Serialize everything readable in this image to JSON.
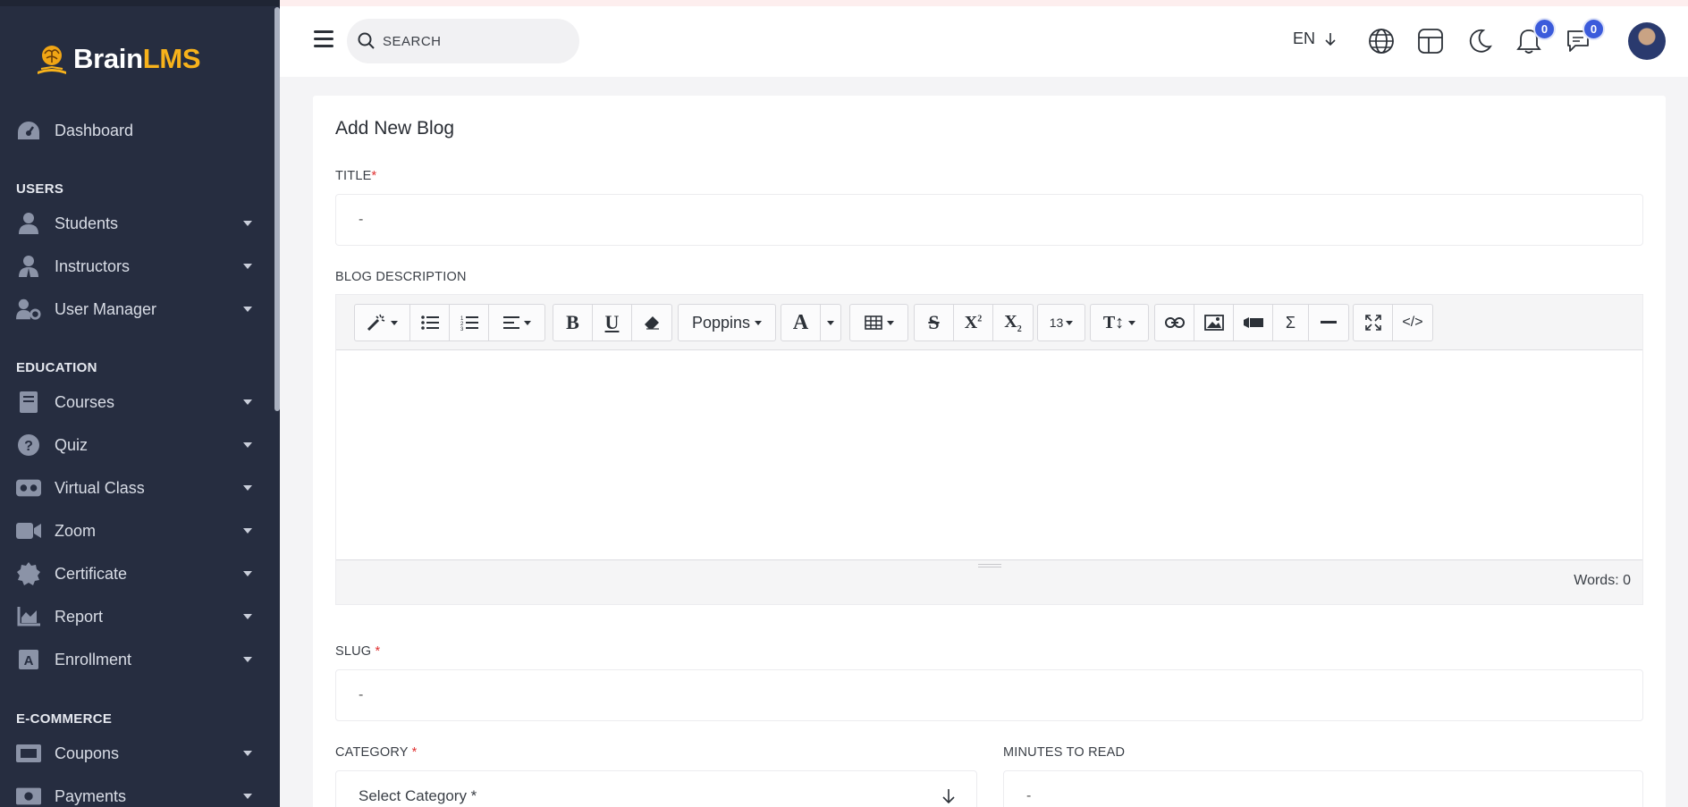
{
  "brand": {
    "name_part1": "Brain",
    "name_part2": "LMS"
  },
  "sidebar": {
    "dashboard": "Dashboard",
    "sections": {
      "users": "USERS",
      "education": "EDUCATION",
      "ecommerce": "E-COMMERCE"
    },
    "users_items": [
      "Students",
      "Instructors",
      "User Manager"
    ],
    "education_items": [
      "Courses",
      "Quiz",
      "Virtual Class",
      "Zoom",
      "Certificate",
      "Report",
      "Enrollment"
    ],
    "ecommerce_items": [
      "Coupons",
      "Payments"
    ]
  },
  "topbar": {
    "search_placeholder": "SEARCH",
    "language": "EN",
    "notifications_count": "0",
    "messages_count": "0"
  },
  "form": {
    "heading": "Add New Blog",
    "title_label": "TITLE",
    "title_required": "*",
    "title_value": "-",
    "description_label": "BLOG DESCRIPTION",
    "font_name": "Poppins",
    "font_size": "13",
    "word_count": "Words: 0",
    "slug_label": "SLUG",
    "slug_required": "*",
    "slug_value": "-",
    "category_label": "CATEGORY",
    "category_required": "*",
    "category_placeholder": "Select Category *",
    "minutes_label": "MINUTES TO READ",
    "minutes_value": "-"
  },
  "colors": {
    "sidebar_bg": "#262d40",
    "accent": "#f7b21b",
    "badge": "#3b5bdb"
  }
}
